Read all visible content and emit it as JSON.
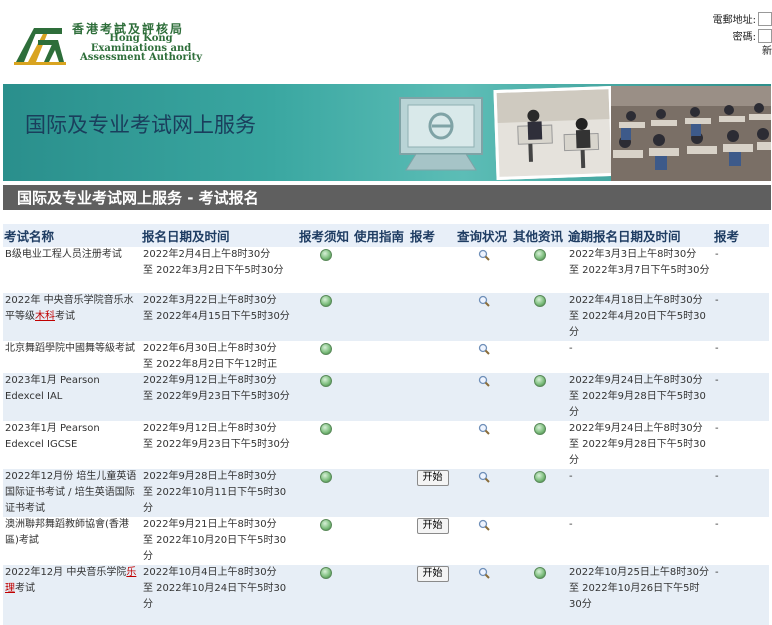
{
  "header": {
    "logo_cn": "香港考試及評核局",
    "logo_en_lines": [
      "Hong Kong",
      "Examinations and",
      "Assessment Authority"
    ],
    "email_label": "電郵地址:",
    "password_label": "密碼:",
    "new_label": "新"
  },
  "banner": {
    "title": "国际及专业考试网上服务"
  },
  "section": {
    "title": "国际及专业考试网上服务 - 考试报名"
  },
  "table": {
    "headers": {
      "name": "考试名称",
      "reg_period": "报名日期及时间",
      "notes": "报考须知",
      "guide": "使用指南",
      "apply": "报考",
      "status": "查询状况",
      "info": "其他资讯",
      "late_period": "逾期报名日期及时间",
      "apply2": "报考"
    },
    "rows": [
      {
        "name": "B级电业工程人员注册考试",
        "reg1": "2022年2月4日上午8时30分",
        "reg2": "至 2022年3月2日下午5时30分",
        "late1": "2022年3月3日上午8时30分",
        "late2": "至 2022年3月7日下午5时30分",
        "apply2": "-"
      },
      {
        "name_a": "2022年 中央音乐学院音乐水平等级",
        "name_b": "木科",
        "name_c": "考试",
        "reg1": "2022年3月22日上午8时30分",
        "reg2": "至 2022年4月15日下午5时30分",
        "late1": "2022年4月18日上午8时30分",
        "late2": "至 2022年4月20日下午5时30分",
        "apply2": "-"
      },
      {
        "name": "北京舞蹈學院中國舞等級考試",
        "reg1": "2022年6月30日上午8时30分",
        "reg2": "至 2022年8月2日下午12时正",
        "late1": "-",
        "apply2": "-"
      },
      {
        "name": "2023年1月 Pearson Edexcel IAL",
        "reg1": "2022年9月12日上午8时30分",
        "reg2": "至 2022年9月23日下午5时30分",
        "late1": "2022年9月24日上午8时30分",
        "late2": "至 2022年9月28日下午5时30分",
        "apply2": "-"
      },
      {
        "name": "2023年1月 Pearson Edexcel IGCSE",
        "reg1": "2022年9月12日上午8时30分",
        "reg2": "至 2022年9月23日下午5时30分",
        "late1": "2022年9月24日上午8时30分",
        "late2": "至 2022年9月28日下午5时30分",
        "apply2": "-"
      },
      {
        "name": "2022年12月份 培生儿童英语国际证书考试 / 培生英语国际证书考试",
        "reg1": "2022年9月28日上午8时30分",
        "reg2": "至 2022年10月11日下午5时30分",
        "button": "开始",
        "late1": "-",
        "apply2": "-"
      },
      {
        "name": "澳洲聯邦舞蹈教師協會(香港區)考試",
        "reg1": "2022年9月21日上午8时30分",
        "reg2": "至 2022年10月20日下午5时30分",
        "button": "开始",
        "late1": "-",
        "apply2": "-"
      },
      {
        "name_a": "2022年12月 中央音乐学院",
        "name_b": "乐理",
        "name_c": "考试",
        "reg1": "2022年10月4日上午8时30分",
        "reg2": "至 2022年10月24日下午5时30分",
        "button": "开始",
        "late1": "2022年10月25日上午8时30分",
        "late2": "至 2022年10月26日下午5时30分",
        "apply2": "-"
      }
    ]
  },
  "colors": {
    "header_text": "#1f3d63",
    "row_alt": "#e7eef6",
    "section_bar": "#5f5f5f",
    "banner": "#3aa7a1",
    "logo": "#2e6e3a"
  },
  "icons": {
    "notes": "globe-icon",
    "status": "magnifier-icon",
    "info": "globe-icon"
  }
}
